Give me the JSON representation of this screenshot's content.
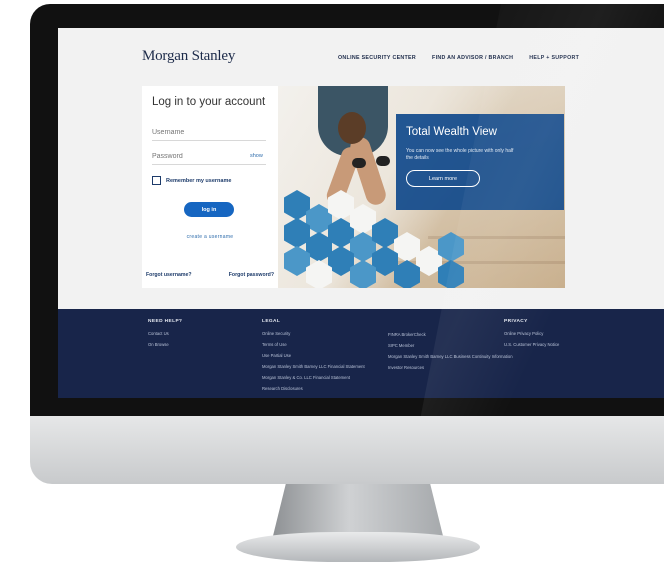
{
  "header": {
    "logo": "Morgan Stanley",
    "nav": [
      "ONLINE SECURITY CENTER",
      "FIND AN ADVISOR / BRANCH",
      "HELP + SUPPORT"
    ]
  },
  "login": {
    "title": "Log in to your account",
    "username_placeholder": "Username",
    "password_placeholder": "Password",
    "show_label": "show",
    "remember_label": "Remember my username",
    "login_button": "log in",
    "create_link": "create a username",
    "forgot_username": "Forgot username?",
    "forgot_password": "Forgot password?"
  },
  "promo": {
    "title": "Total Wealth View",
    "text": "You can now see the whole picture with only half the details",
    "button": "Learn more"
  },
  "footer": {
    "help": {
      "heading": "NEED HELP?",
      "links": [
        "Contact Us",
        "On Browse"
      ]
    },
    "legal": {
      "heading": "LEGAL",
      "links": [
        "Online Security",
        "Terms of Use",
        "Use Partial Use",
        "Morgan Stanley Smith Barney LLC Financial Statement",
        "Morgan Stanley & Co. LLC Financial Statement",
        "Research Disclosures"
      ],
      "links2": [
        "FINRA BrokerCheck",
        "SIPC Member",
        "Morgan Stanley Smith Barney LLC Business Continuity Information",
        "Investor Resources"
      ]
    },
    "privacy": {
      "heading": "PRIVACY",
      "links": [
        "Online Privacy Policy",
        "U.S. Customer Privacy Notice"
      ]
    }
  },
  "colors": {
    "brand_navy": "#18254a",
    "button_blue": "#1666c1",
    "promo_blue": "#124a8c"
  }
}
